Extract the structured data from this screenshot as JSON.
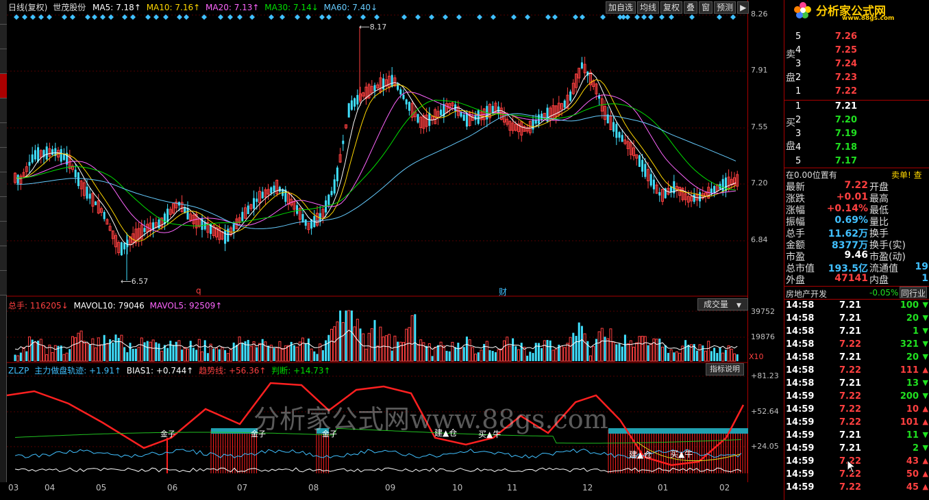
{
  "legend": {
    "prefix": "日线(复权)",
    "stock": "世茂股份",
    "ma5": "MA5: 7.18↑",
    "ma10": "MA10: 7.16↑",
    "ma20": "MA20: 7.13↑",
    "ma30": "MA30: 7.14↓",
    "ma60": "MA60: 7.40↓"
  },
  "toolbar": {
    "add": "加自选",
    "avg": "均线",
    "fq": "复权",
    "stack": "叠",
    "win": "窗",
    "predict": "预测",
    "arrow": "▶"
  },
  "price_axis": [
    "8.26",
    "7.91",
    "7.55",
    "7.20",
    "6.84"
  ],
  "annotations": {
    "high": "8.17",
    "low": "6.57",
    "q_mark": "q",
    "cai_mark": "财"
  },
  "volume": {
    "hdr_total": "总手: 116205↓",
    "hdr_mavol10": "MAVOL10: 79046",
    "hdr_mavol5": "MAVOL5: 92509↑",
    "axis_top": "39752",
    "axis_mid": "19876",
    "axis_unit": "X10",
    "dropdown": "成交量",
    "arrow": "▼"
  },
  "indicator": {
    "name": "ZLZP",
    "l1": "主力做盘轨迹: +1.91↑",
    "l2": "BIAS1: +0.744↑",
    "l3": "趋势线: +56.36↑",
    "l4": "判断: +14.73↑",
    "btn": "指标说明",
    "axis_top": "+81.23",
    "axis_mid": "+52.64",
    "axis_low": "+24.05",
    "sig_jin1": "金子",
    "sig_jin2": "金子",
    "sig_jin3": "金子",
    "sig_jian1": "建▲仓",
    "sig_buy1": "买▲牛",
    "sig_jian2": "建▲仓",
    "sig_buy2": "买▲牛"
  },
  "months": [
    "03",
    "04",
    "05",
    "06",
    "07",
    "08",
    "09",
    "10",
    "11",
    "12",
    "01",
    "02"
  ],
  "watermark": "分析家公式网www.88gs.com",
  "logo": {
    "text": "分析家公式网",
    "url": "www.88gs.com"
  },
  "orderbook": {
    "sell_label": [
      "卖",
      "盘"
    ],
    "buy_label": [
      "买",
      "盘"
    ],
    "sell": [
      {
        "lv": "5",
        "p": "7.26"
      },
      {
        "lv": "4",
        "p": "7.25"
      },
      {
        "lv": "3",
        "p": "7.24"
      },
      {
        "lv": "2",
        "p": "7.23"
      },
      {
        "lv": "1",
        "p": "7.22"
      }
    ],
    "buy": [
      {
        "lv": "1",
        "p": "7.21"
      },
      {
        "lv": "2",
        "p": "7.20"
      },
      {
        "lv": "3",
        "p": "7.19"
      },
      {
        "lv": "4",
        "p": "7.18"
      },
      {
        "lv": "5",
        "p": "7.17"
      }
    ]
  },
  "position_line": {
    "left": "在0.00位置有",
    "right": "卖单! 查"
  },
  "stats": [
    {
      "k": "最新",
      "v": "7.22",
      "c": "up",
      "k2": "开盘"
    },
    {
      "k": "涨跌",
      "v": "+0.01",
      "c": "up",
      "k2": "最高"
    },
    {
      "k": "涨幅",
      "v": "+0.14%",
      "c": "up",
      "k2": "最低"
    },
    {
      "k": "振幅",
      "v": "0.69%",
      "c": "cy",
      "k2": "量比"
    },
    {
      "k": "总手",
      "v": "11.62万",
      "c": "cy",
      "k2": "换手"
    },
    {
      "k": "金额",
      "v": "8377万",
      "c": "cy",
      "k2": "换手(实)"
    },
    {
      "k": "市盈",
      "v": "9.46",
      "c": "wh",
      "k2": "市盈(动)"
    },
    {
      "k": "总市值",
      "v": "193.5亿",
      "c": "cy",
      "k2": "流通值",
      "v2": "19"
    },
    {
      "k": "外盘",
      "v": "47141",
      "c": "up",
      "k2": "内盘",
      "v2": "1"
    }
  ],
  "sector": {
    "name": "房地产开发",
    "pct": "-0.05%",
    "btn": "同行业"
  },
  "ticks": [
    {
      "t": "14:58",
      "p": "7.21",
      "pc": "wh",
      "v": "100",
      "d": "dn"
    },
    {
      "t": "14:58",
      "p": "7.21",
      "pc": "wh",
      "v": "20",
      "d": "dn"
    },
    {
      "t": "14:58",
      "p": "7.21",
      "pc": "wh",
      "v": "1",
      "d": "dn"
    },
    {
      "t": "14:58",
      "p": "7.22",
      "pc": "up",
      "v": "321",
      "d": "dn"
    },
    {
      "t": "14:58",
      "p": "7.21",
      "pc": "wh",
      "v": "20",
      "d": "dn"
    },
    {
      "t": "14:58",
      "p": "7.22",
      "pc": "up",
      "v": "111",
      "d": "up"
    },
    {
      "t": "14:58",
      "p": "7.21",
      "pc": "wh",
      "v": "13",
      "d": "dn"
    },
    {
      "t": "14:59",
      "p": "7.22",
      "pc": "up",
      "v": "200",
      "d": "dn"
    },
    {
      "t": "14:59",
      "p": "7.22",
      "pc": "up",
      "v": "10",
      "d": "up"
    },
    {
      "t": "14:59",
      "p": "7.22",
      "pc": "up",
      "v": "101",
      "d": "up"
    },
    {
      "t": "14:59",
      "p": "7.21",
      "pc": "wh",
      "v": "11",
      "d": "dn"
    },
    {
      "t": "14:59",
      "p": "7.21",
      "pc": "wh",
      "v": "2",
      "d": "dn"
    },
    {
      "t": "14:59",
      "p": "7.22",
      "pc": "up",
      "v": "43",
      "d": "up"
    },
    {
      "t": "14:59",
      "p": "7.22",
      "pc": "up",
      "v": "50",
      "d": "up"
    },
    {
      "t": "14:59",
      "p": "7.22",
      "pc": "up",
      "v": "45",
      "d": "up"
    }
  ],
  "colors": {
    "ma5": "#ffffff",
    "ma10": "#ffd700",
    "ma20": "#ff66ff",
    "ma30": "#00e000",
    "ma60": "#66ccff",
    "up": "#ff4040",
    "down": "#40e0ff",
    "trend": "#ff2020"
  }
}
